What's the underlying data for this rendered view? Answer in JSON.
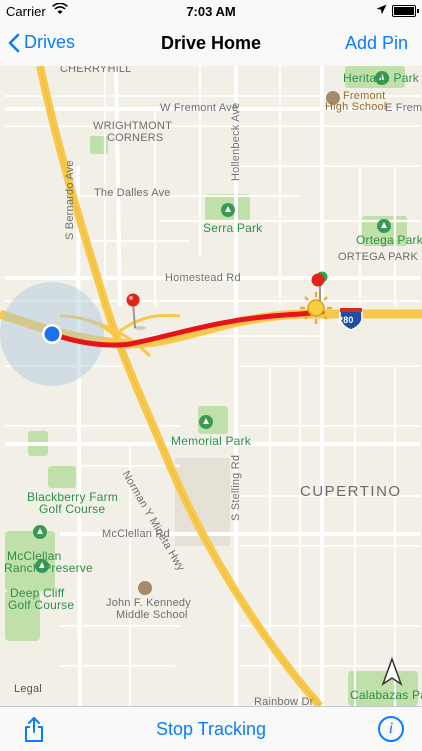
{
  "status": {
    "carrier": "Carrier",
    "time": "7:03 AM"
  },
  "nav": {
    "back_label": "Drives",
    "title": "Drive Home",
    "right_label": "Add Pin"
  },
  "map": {
    "labels": {
      "cherryhill": "CHERRYHILL",
      "wrightmont": "WRIGHTMONT",
      "corners": "CORNERS",
      "heritage_park": "Heritage Park",
      "fremont_high": "Fremont",
      "fremont_high2": "High School",
      "w_fremont_ave": "W Fremont Ave",
      "e_fre": "E Frem",
      "dalles": "The Dalles Ave",
      "serra_park": "Serra Park",
      "ortega_park": "Ortega Park",
      "ortega_park_district": "ORTEGA PARK",
      "homestead": "Homestead Rd",
      "memorial_park": "Memorial Park",
      "cupertino": "CUPERTINO",
      "blackberry1": "Blackberry Farm",
      "blackberry2": "Golf Course",
      "mcclellan_rd": "McClellan Rd",
      "mcclellan_ranch1": "McClellan",
      "mcclellan_ranch2": "Ranch Preserve",
      "deep_cliff1": "Deep Cliff",
      "deep_cliff2": "Golf Course",
      "kennedy1": "John F. Kennedy",
      "kennedy2": "Middle School",
      "legal": "Legal",
      "calabazas": "Calabazas Pa",
      "rainbow": "Rainbow Dr",
      "s_bernardo": "S Bernardo Ave",
      "hollenbeck": "Hollenbeck Ave",
      "s_stelling": "S Stelling Rd",
      "norman_y_mineta": "Norman Y Mineta Hwy",
      "shield_280": "280"
    }
  },
  "toolbar": {
    "stop_label": "Stop Tracking"
  },
  "colors": {
    "accent": "#0a7cff",
    "route": "#e8121a",
    "highway": "#f7c84a"
  }
}
